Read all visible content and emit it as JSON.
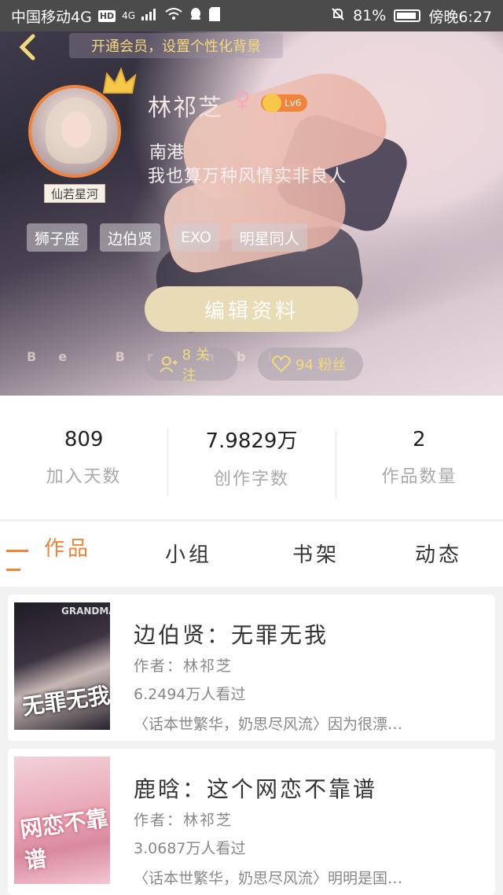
{
  "status_bar": {
    "carrier": "中国移动4G",
    "hd": "HD",
    "network": "4G",
    "battery": "81%",
    "time": "傍晚6:27"
  },
  "header": {
    "vip_banner": "开通会员，设置个性化背景",
    "avatar_caption": "仙若星河",
    "name": "林祁芝",
    "gender": "♀",
    "level": "Lv6",
    "location": "南港",
    "bio": "我也算万种风情实非良人",
    "tags": [
      "狮子座",
      "边伯贤",
      "EXO",
      "明星同人"
    ],
    "edit_label": "编辑资料",
    "bg_text": "Be Br      mbl ",
    "follow_label": "8 关注",
    "fans_label": "94 粉丝"
  },
  "stats": [
    {
      "value": "809",
      "label": "加入天数"
    },
    {
      "value": "7.9829万",
      "label": "创作字数"
    },
    {
      "value": "2",
      "label": "作品数量"
    }
  ],
  "tabs": [
    "作品",
    "小组",
    "书架",
    "动态"
  ],
  "works": [
    {
      "title": "边伯贤：无罪无我",
      "author": "作者：林祁芝",
      "views": "6.2494万人看过",
      "desc": "〈话本世繁华，奶思尽风流〉因为很漂…",
      "cover_text": "无罪无我",
      "cover_top": "GRANDMA"
    },
    {
      "title": "鹿晗：这个网恋不靠谱",
      "author": "作者：林祁芝",
      "views": "3.0687万人看过",
      "desc": "〈话本世繁华，奶思尽风流〉明明是国…",
      "cover_text": "网恋不靠谱"
    }
  ],
  "colors": {
    "accent": "#f0843c",
    "gold": "#f5d97c",
    "edit_button": "#e9dbb5"
  }
}
